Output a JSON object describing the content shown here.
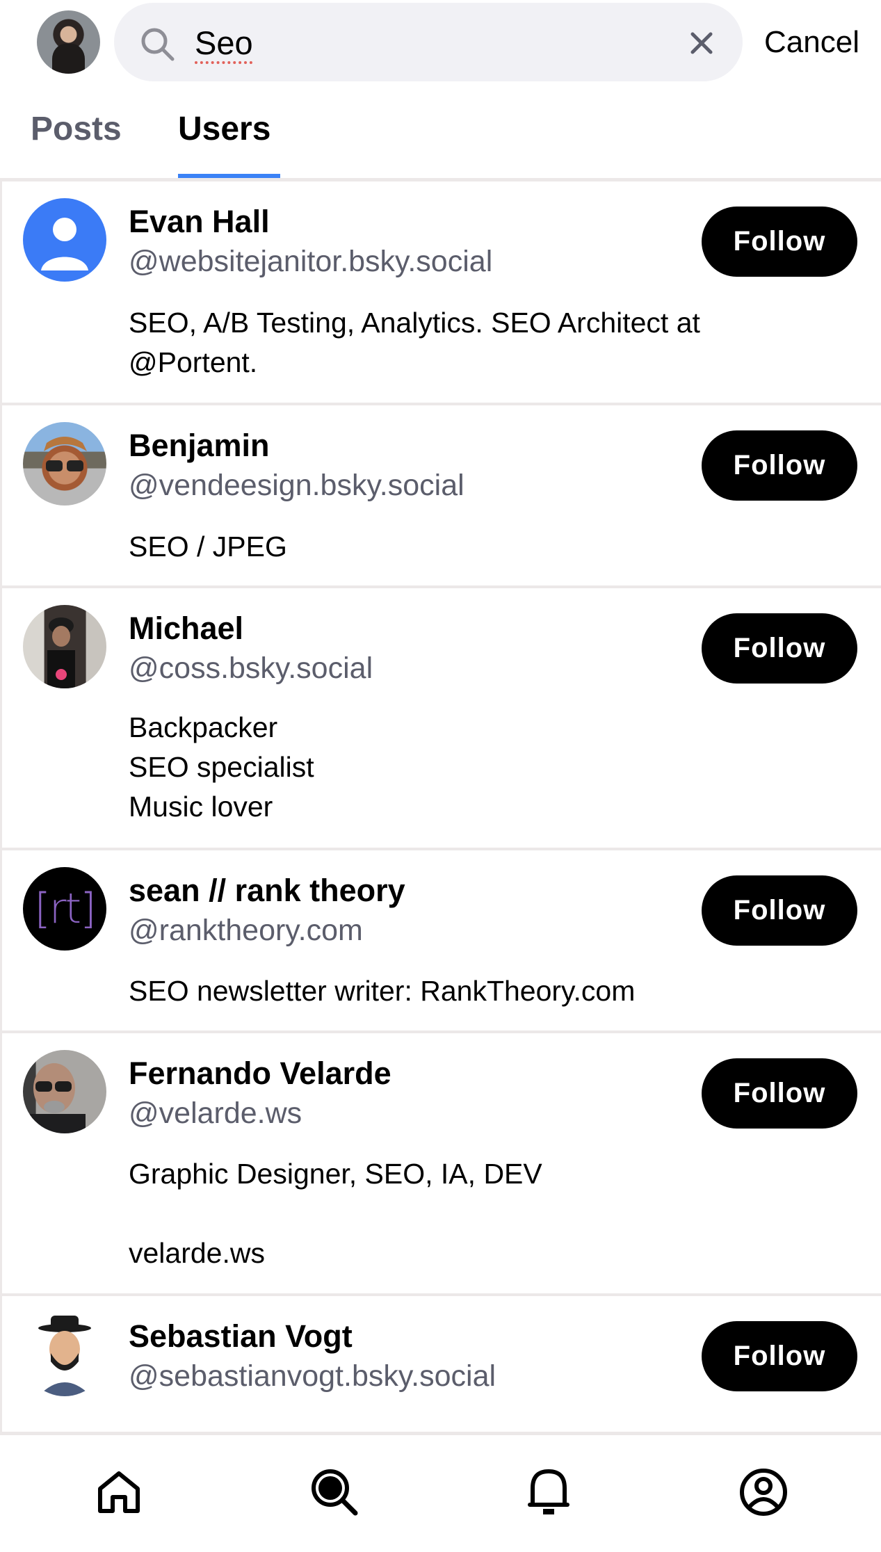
{
  "header": {
    "search": {
      "value": "Seo",
      "clear_icon": "close-icon",
      "search_icon": "search-icon"
    },
    "cancel_label": "Cancel",
    "avatar": "current-user-avatar"
  },
  "tabs": [
    {
      "label": "Posts",
      "active": false
    },
    {
      "label": "Users",
      "active": true
    }
  ],
  "colors": {
    "accent": "#3b82f6",
    "follow_bg": "#000000",
    "handle": "#5b5d6b",
    "divider": "#ece8e8",
    "search_bg": "#f1f1f5"
  },
  "users": [
    {
      "name": "Evan Hall",
      "handle": "@websitejanitor.bsky.social",
      "bio": "SEO, A/B Testing, Analytics. SEO Architect at\n@Portent.",
      "follow_label": "Follow",
      "avatar": "default-avatar"
    },
    {
      "name": "Benjamin",
      "handle": "@vendeesign.bsky.social",
      "bio": "SEO / JPEG",
      "follow_label": "Follow",
      "avatar": "photo"
    },
    {
      "name": "Michael",
      "handle": "@coss.bsky.social",
      "bio": "Backpacker\nSEO specialist\nMusic lover",
      "follow_label": "Follow",
      "avatar": "photo"
    },
    {
      "name": "sean // rank theory",
      "handle": "@ranktheory.com",
      "bio": "SEO newsletter writer: RankTheory.com",
      "follow_label": "Follow",
      "avatar": "logo",
      "avatar_text": "[rt]"
    },
    {
      "name": "Fernando Velarde",
      "handle": "@velarde.ws",
      "bio": "Graphic Designer, SEO, IA, DEV\n\nvelarde.ws",
      "follow_label": "Follow",
      "avatar": "photo"
    },
    {
      "name": "Sebastian Vogt",
      "handle": "@sebastianvogt.bsky.social",
      "bio": "",
      "follow_label": "Follow",
      "avatar": "photo"
    }
  ],
  "bottom_nav": [
    {
      "icon": "home-icon",
      "active": false
    },
    {
      "icon": "search-icon",
      "active": true
    },
    {
      "icon": "bell-icon",
      "active": false
    },
    {
      "icon": "profile-icon",
      "active": false
    }
  ]
}
